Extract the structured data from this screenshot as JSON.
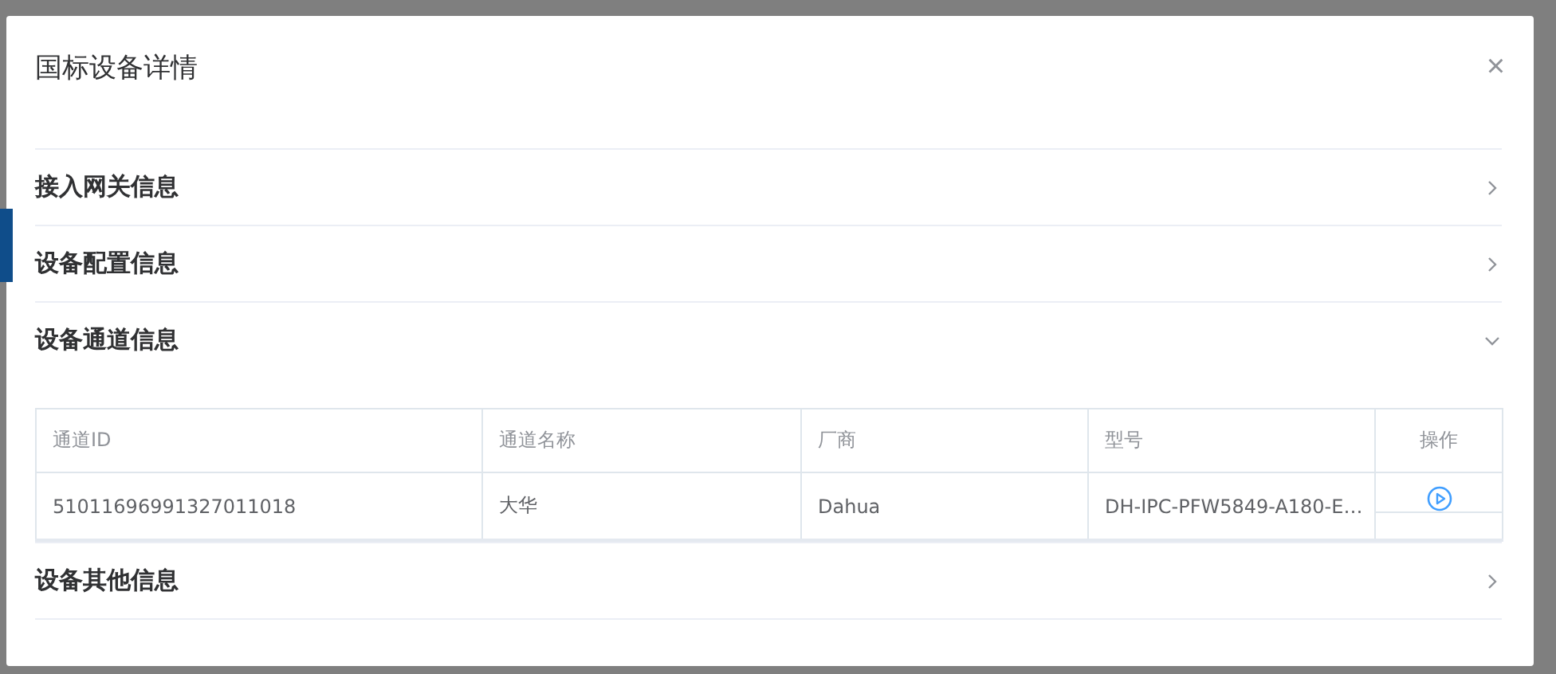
{
  "dialog": {
    "title": "国标设备详情",
    "close": "×"
  },
  "sections": [
    {
      "title": "接入网关信息",
      "expanded": false
    },
    {
      "title": "设备配置信息",
      "expanded": false
    },
    {
      "title": "设备通道信息",
      "expanded": true,
      "table": {
        "columns": [
          "通道ID",
          "通道名称",
          "厂商",
          "型号",
          "操作"
        ],
        "rows": [
          [
            "51011696991327011018",
            "大华",
            "Dahua",
            "DH-IPC-PFW5849-A180-E…"
          ]
        ]
      }
    },
    {
      "title": "设备其他信息",
      "expanded": false
    }
  ]
}
